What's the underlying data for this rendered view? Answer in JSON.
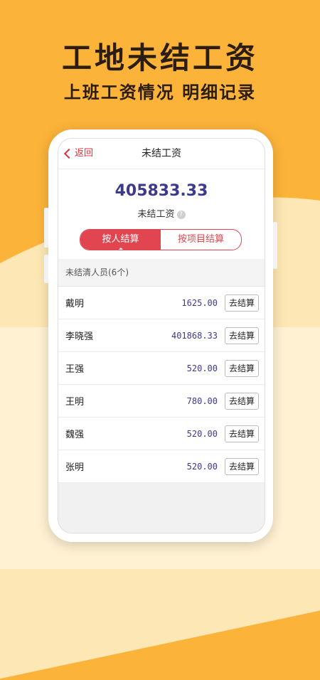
{
  "promo": {
    "headline": "工地未结工资",
    "subline": "上班工资情况  明细记录"
  },
  "nav": {
    "back_label": "返回",
    "title": "未结工资"
  },
  "summary": {
    "total_value": "405833.33",
    "total_label": "未结工资",
    "help_glyph": "?"
  },
  "segments": [
    {
      "label": "按人结算",
      "active": true
    },
    {
      "label": "按项目结算",
      "active": false
    }
  ],
  "section": {
    "header": "未结清人员(6个)"
  },
  "workers": [
    {
      "name": "戴明",
      "amount": "1625.00",
      "action": "去结算"
    },
    {
      "name": "李晓强",
      "amount": "401868.33",
      "action": "去结算"
    },
    {
      "name": "王强",
      "amount": "520.00",
      "action": "去结算"
    },
    {
      "name": "王明",
      "amount": "780.00",
      "action": "去结算"
    },
    {
      "name": "魏强",
      "amount": "520.00",
      "action": "去结算"
    },
    {
      "name": "张明",
      "amount": "520.00",
      "action": "去结算"
    }
  ],
  "colors": {
    "accent": "#e14650",
    "amount": "#3d3a8c",
    "background": "#fbb33a"
  }
}
